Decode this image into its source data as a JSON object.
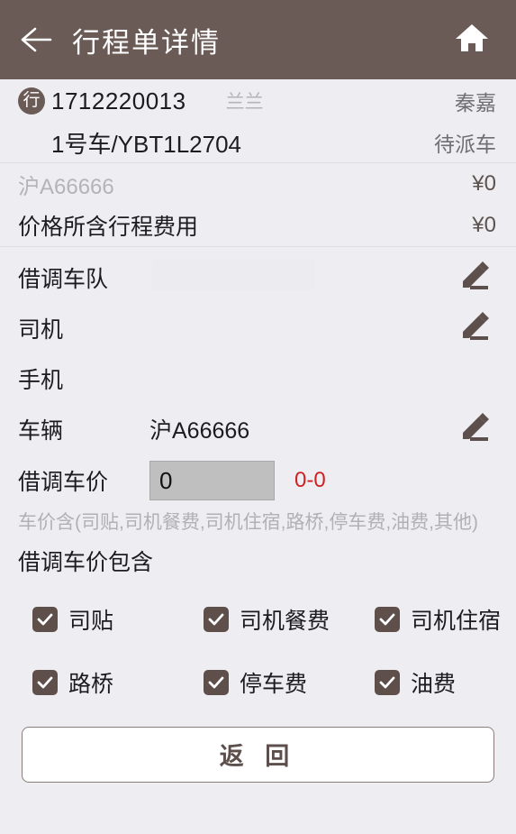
{
  "header": {
    "title": "行程单详情",
    "back_icon": "arrow-left-icon",
    "home_icon": "home-icon"
  },
  "order": {
    "badge": "行",
    "number": "1712220013",
    "customer": "兰兰",
    "operator": "秦嘉",
    "vehicle_line": "1号车/YBT1L2704",
    "status": "待派车"
  },
  "prices": [
    {
      "label": "沪A66666",
      "value": "¥0",
      "muted": true
    },
    {
      "label": "价格所含行程费用",
      "value": "¥0",
      "muted": false
    }
  ],
  "form": [
    {
      "label": "借调车队",
      "value": "",
      "edit": true
    },
    {
      "label": "司机",
      "value": "",
      "edit": true
    },
    {
      "label": "手机",
      "value": "",
      "edit": false
    },
    {
      "label": "车辆",
      "value": "沪A66666",
      "edit": true
    }
  ],
  "price_input": {
    "label": "借调车价",
    "value": "0",
    "placeholder": "0",
    "range": "0-0"
  },
  "hint": "车价含(司贴,司机餐费,司机住宿,路桥,停车费,油费,其他)",
  "section_title": "借调车价包含",
  "checkboxes": [
    [
      {
        "label": "司贴",
        "checked": true
      },
      {
        "label": "司机餐费",
        "checked": true
      },
      {
        "label": "司机住宿",
        "checked": true
      }
    ],
    [
      {
        "label": "路桥",
        "checked": true
      },
      {
        "label": "停车费",
        "checked": true
      },
      {
        "label": "油费",
        "checked": true
      }
    ]
  ],
  "footer": {
    "return_label": "返 回"
  },
  "colors": {
    "header_bg": "#6b5b57",
    "page_bg": "#eeeef2",
    "accent": "#5e4f4b",
    "danger": "#cc2222",
    "muted": "#b3b3b8"
  }
}
